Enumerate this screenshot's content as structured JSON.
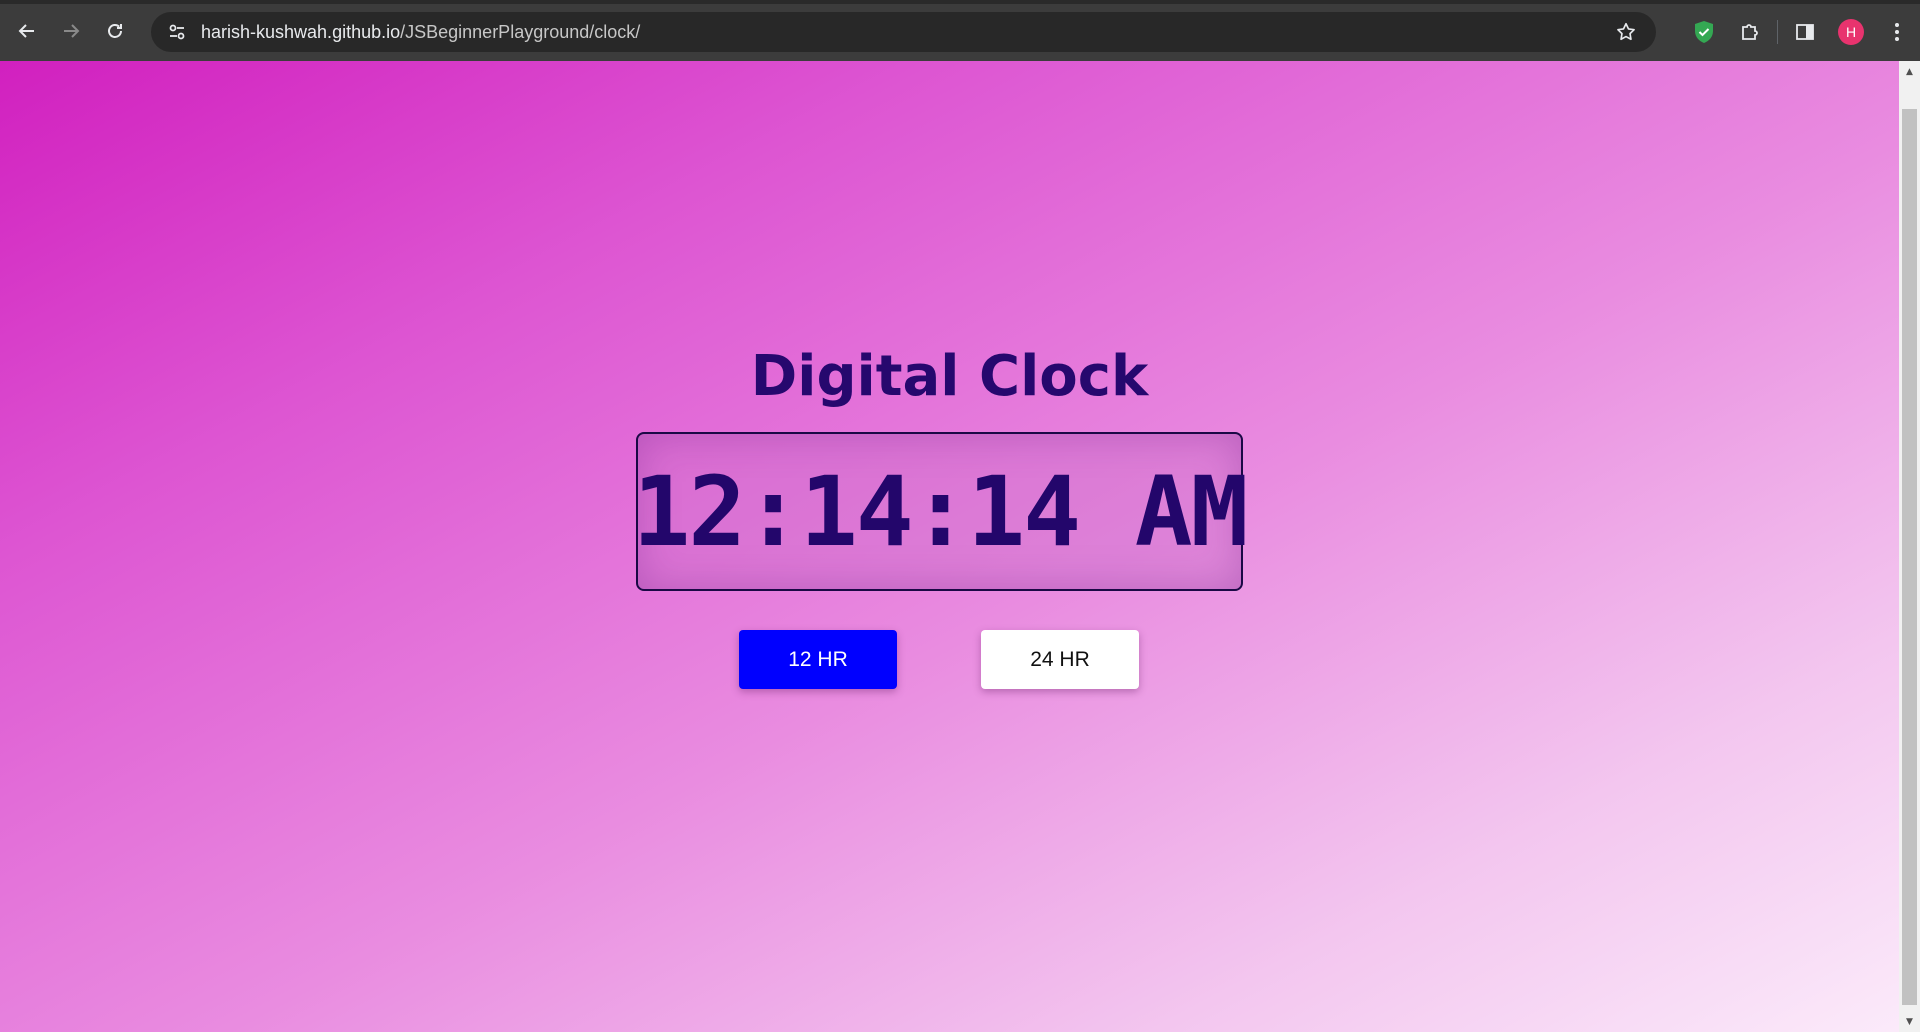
{
  "browser": {
    "url_host": "harish-kushwah.github.io",
    "url_path": "/JSBeginnerPlayground/clock/",
    "avatar_letter": "H",
    "icons": {
      "back": "arrow-left-icon",
      "forward": "arrow-right-icon",
      "reload": "reload-icon",
      "site_info": "tune-icon",
      "bookmark": "star-icon",
      "shield": "shield-check-icon",
      "extensions": "puzzle-icon",
      "sidepanel": "side-panel-icon",
      "menu": "kebab-menu-icon"
    }
  },
  "page": {
    "title": "Digital Clock",
    "time": "12:14:14 AM",
    "buttons": {
      "twelve": "12 HR",
      "twentyfour": "24 HR"
    }
  },
  "colors": {
    "title": "#26086e",
    "active_button": "#0000ff",
    "inactive_button": "#ffffff",
    "gradient_start": "#d120bf",
    "gradient_end": "#fbeafa"
  }
}
